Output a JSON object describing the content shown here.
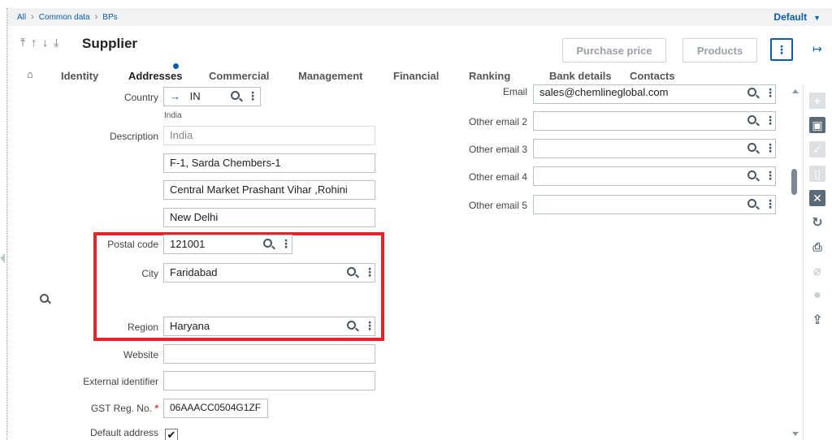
{
  "breadcrumb": [
    "All",
    "Common data",
    "BPs"
  ],
  "default_label": "Default",
  "header": {
    "nav_arrows": [
      "⤒",
      "↑",
      "↓",
      "⤓"
    ],
    "title": "Supplier",
    "purchase_price_label": "Purchase price",
    "products_label": "Products"
  },
  "tabs": [
    "Identity",
    "Addresses",
    "Commercial",
    "Management",
    "Financial",
    "Ranking",
    "Bank details",
    "Contacts"
  ],
  "active_tab": "Addresses",
  "form_left": {
    "country_label": "Country",
    "country_value": "IN",
    "country_name": "India",
    "description_label": "Description",
    "description_value": "India",
    "address_line1": "F-1, Sarda Chembers-1",
    "address_line2": "Central Market Prashant Vihar ,Rohini",
    "address_line3": "New Delhi",
    "postal_code_label": "Postal code",
    "postal_code_value": "121001",
    "city_label": "City",
    "city_value": "Faridabad",
    "region_label": "Region",
    "region_value": "Haryana",
    "website_label": "Website",
    "website_value": "",
    "external_id_label": "External identifier",
    "external_id_value": "",
    "gst_label": "GST Reg. No.",
    "gst_value": "06AAACC0504G1ZF",
    "default_address_label": "Default address",
    "default_address_checked": true
  },
  "form_right": {
    "email_label": "Email",
    "email_value": "sales@chemlineglobal.com",
    "other_email_labels": [
      "Other email 2",
      "Other email 3",
      "Other email 4",
      "Other email 5"
    ],
    "other_email_values": [
      "",
      "",
      "",
      ""
    ]
  },
  "colors": {
    "accent": "#0b5ea8",
    "highlight_box": "#e02626",
    "required": "#e03a2a"
  },
  "icons": {
    "country_arrow": "→",
    "kebab": "⋮",
    "checkmark": "✔",
    "more": "⋮",
    "exit": "↦"
  }
}
